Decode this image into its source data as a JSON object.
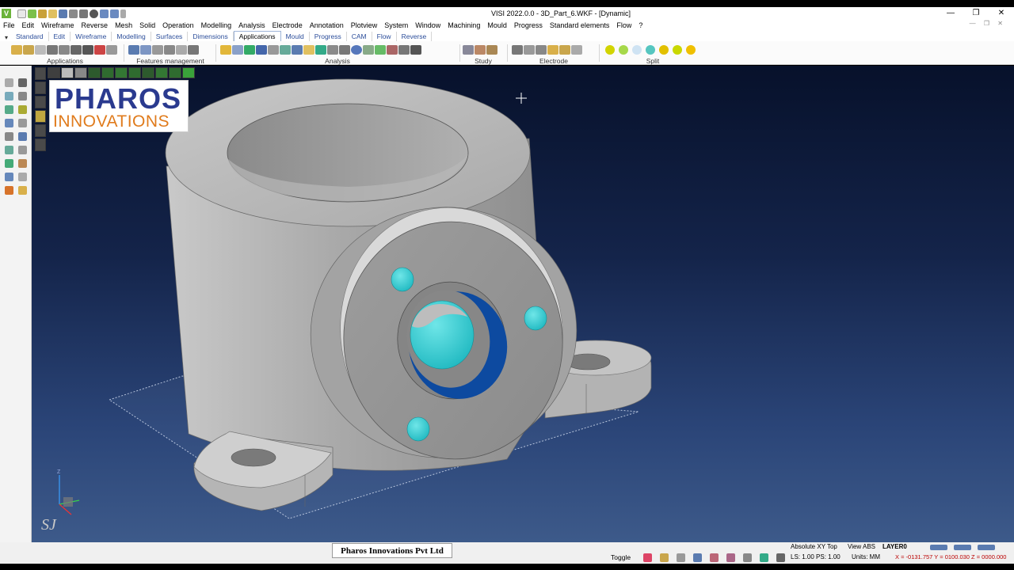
{
  "window": {
    "title": "VISI 2022.0.0 - 3D_Part_6.WKF - [Dynamic]",
    "app_icon_letter": "V",
    "controls": [
      "—",
      "❐",
      "✕"
    ]
  },
  "menu": {
    "items": [
      "File",
      "Edit",
      "Wireframe",
      "Reverse",
      "Mesh",
      "Solid",
      "Operation",
      "Modelling",
      "Analysis",
      "Electrode",
      "Annotation",
      "Plotview",
      "System",
      "Window",
      "Machining",
      "Mould",
      "Progress",
      "Standard elements",
      "Flow",
      "?"
    ]
  },
  "tabs": {
    "items": [
      "Standard",
      "Edit",
      "Wireframe",
      "Modelling",
      "Surfaces",
      "Dimensions",
      "Applications",
      "Mould",
      "Progress",
      "CAM",
      "Flow",
      "Reverse"
    ],
    "active": "Applications"
  },
  "ribbon": {
    "groups": [
      "Applications",
      "Features management",
      "Analysis",
      "Study",
      "Electrode",
      "Split"
    ]
  },
  "logo": {
    "main": "PHAROS",
    "sub": "INNOVATIONS"
  },
  "watermark": "SJ",
  "footer": {
    "company": "Pharos Innovations Pvt Ltd"
  },
  "status": {
    "toggle": "Toggle",
    "view_mode": "Absolute XY Top",
    "view_abs": "View ABS",
    "layer": "LAYER0",
    "ls": "LS: 1.00 PS: 1.00",
    "units": "Units: MM",
    "coords": "X = -0131.757 Y = 0100.030 Z = 0000.000"
  },
  "colors": {
    "accent_cyan": "#27c9cf",
    "bore_blue": "#0d4aa0",
    "part_gray": "#a9a9a9",
    "logo_blue": "#2a3a8f",
    "logo_orange": "#e07b1c"
  }
}
